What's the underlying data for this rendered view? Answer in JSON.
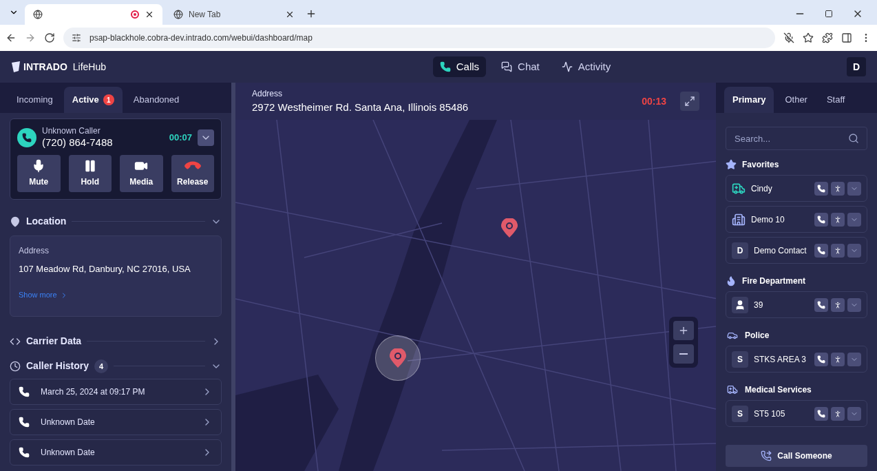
{
  "browser": {
    "tabs": [
      {
        "selected": true,
        "recording": true
      },
      {
        "title": "New Tab",
        "selected": false,
        "recording": false
      }
    ],
    "url": "psap-blackhole.cobra-dev.intrado.com/webui/dashboard/map"
  },
  "header": {
    "logo": "INTRADO",
    "product": "LifeHub",
    "nav": [
      {
        "label": "Calls",
        "kind": "calls",
        "selected": true
      },
      {
        "label": "Chat",
        "kind": "chat",
        "selected": false
      },
      {
        "label": "Activity",
        "kind": "activity",
        "selected": false
      }
    ],
    "user_initial": "D"
  },
  "call_tabs": [
    {
      "label": "Incoming",
      "selected": false
    },
    {
      "label": "Active",
      "selected": true,
      "badge": "1"
    },
    {
      "label": "Abandoned",
      "selected": false
    }
  ],
  "call": {
    "caller": "Unknown Caller",
    "number": "(720) 864-7488",
    "timer": "00:07",
    "actions": [
      {
        "label": "Mute",
        "kind": "mute"
      },
      {
        "label": "Hold",
        "kind": "hold"
      },
      {
        "label": "Media",
        "kind": "media"
      },
      {
        "label": "Release",
        "kind": "release"
      }
    ]
  },
  "location": {
    "title": "Location",
    "expanded": true,
    "address_label": "Address",
    "address": "107 Meadow Rd, Danbury, NC 27016, USA",
    "show_more": "Show more"
  },
  "carrier_data": {
    "title": "Carrier Data",
    "expanded": false
  },
  "caller_history": {
    "title": "Caller History",
    "count": "4",
    "expanded": true,
    "items": [
      "March 25, 2024 at 09:17 PM",
      "Unknown Date",
      "Unknown Date"
    ]
  },
  "map": {
    "address_label": "Address",
    "address": "2972 Westheimer Rd. Santa Ana, Illinois 85486",
    "timer": "00:13"
  },
  "directory_tabs": [
    {
      "label": "Primary",
      "selected": true
    },
    {
      "label": "Other",
      "selected": false
    },
    {
      "label": "Staff",
      "selected": false
    }
  ],
  "search": {
    "placeholder": "Search..."
  },
  "groups": [
    {
      "title": "Favorites",
      "kind": "favorites",
      "contacts": [
        {
          "name": "Cindy",
          "kind": "ambulance"
        },
        {
          "name": "Demo 10",
          "kind": "building"
        },
        {
          "name": "Demo Contact",
          "kind": "initial",
          "initial": "D"
        }
      ]
    },
    {
      "title": "Fire Department",
      "kind": "fire",
      "contacts": [
        {
          "name": "39",
          "kind": "person"
        }
      ]
    },
    {
      "title": "Police",
      "kind": "police",
      "contacts": [
        {
          "name": "STKS AREA 3",
          "kind": "initial",
          "initial": "S"
        }
      ]
    },
    {
      "title": "Medical Services",
      "kind": "medical",
      "contacts": [
        {
          "name": "ST5 105",
          "kind": "initial",
          "initial": "S"
        }
      ]
    }
  ],
  "call_someone": "Call Someone"
}
